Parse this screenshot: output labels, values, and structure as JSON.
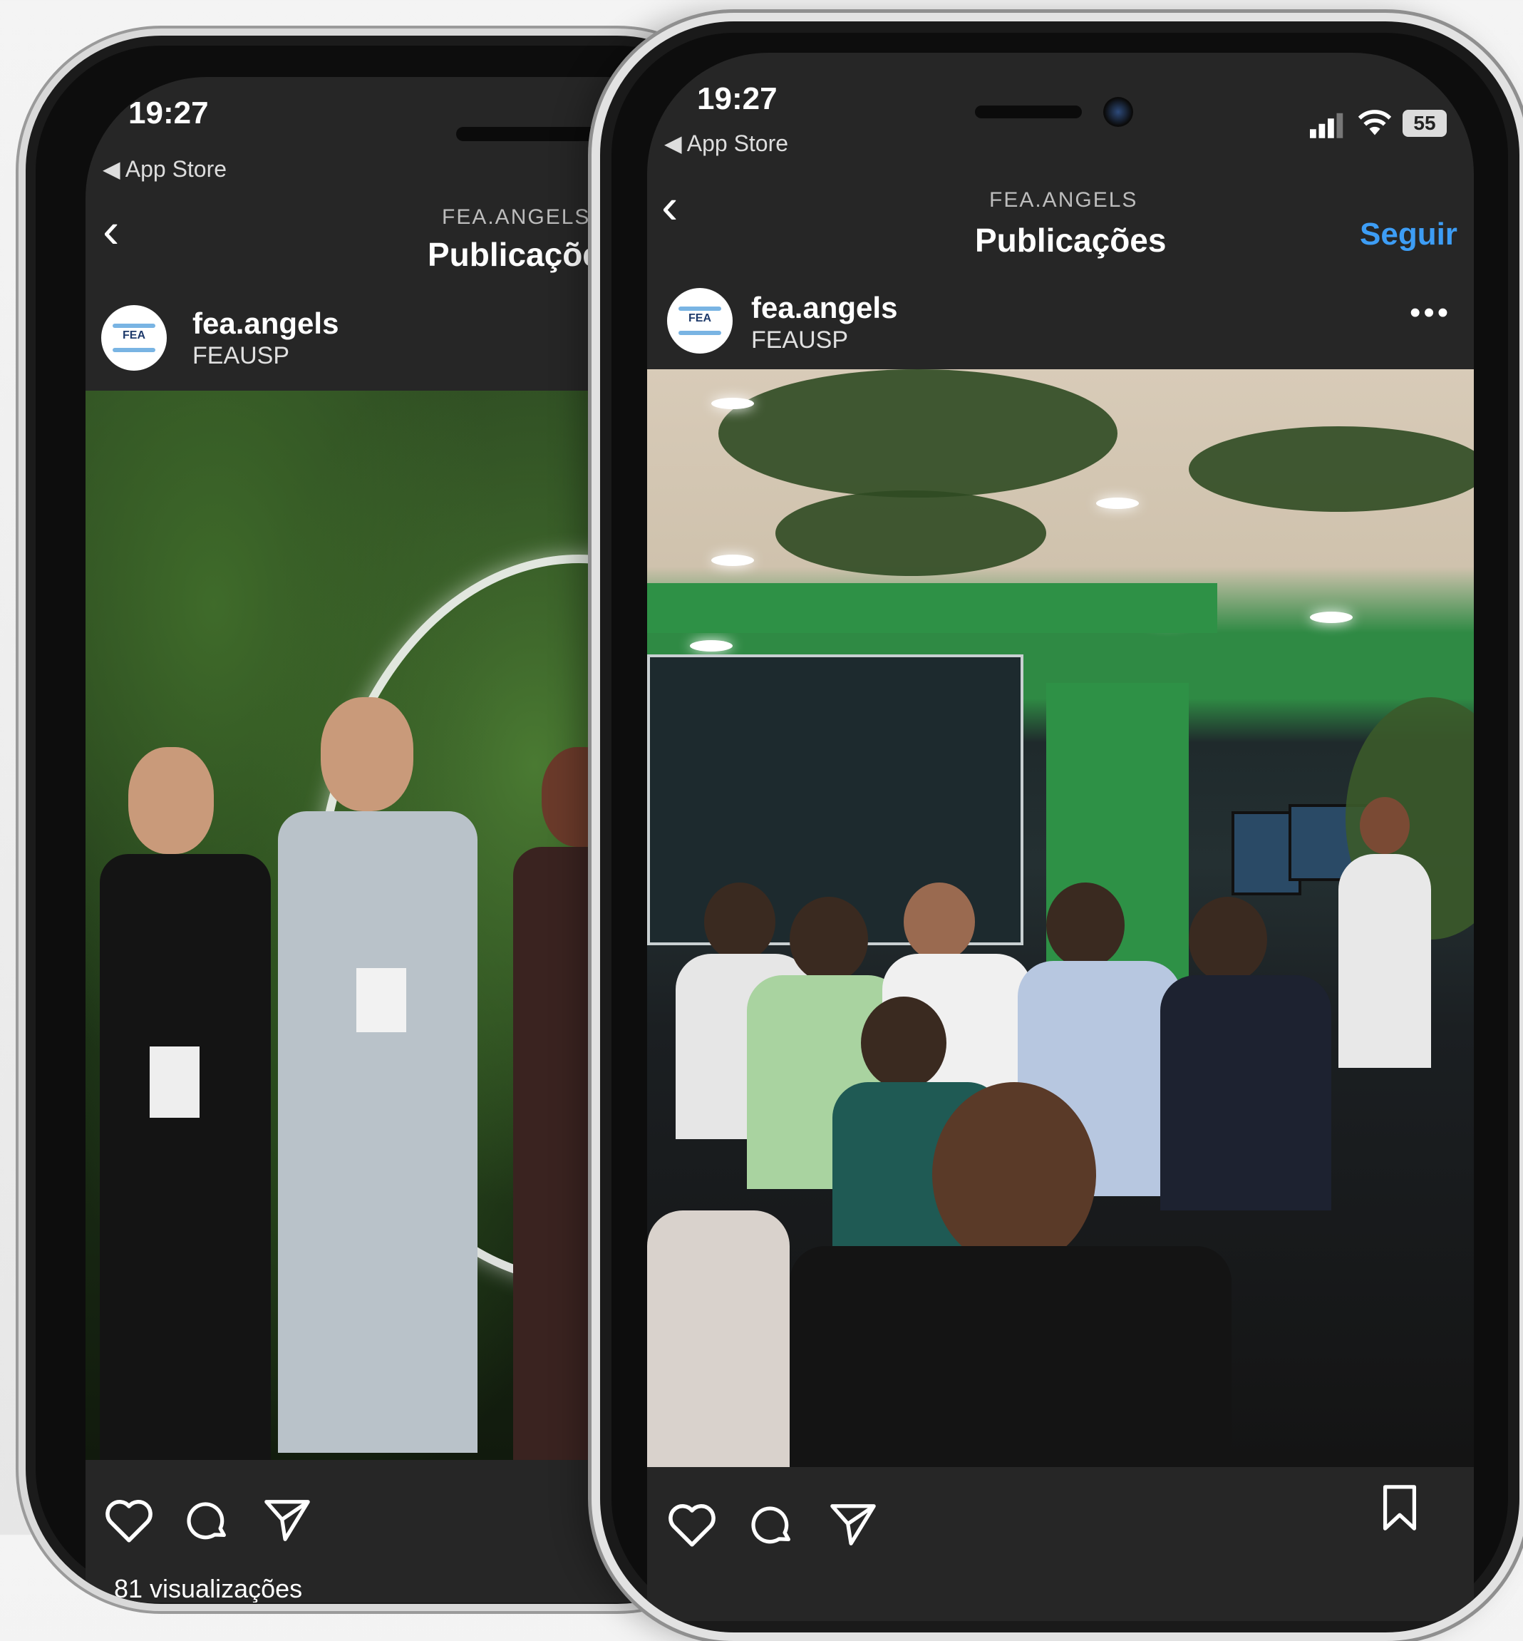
{
  "back_phone": {
    "status": {
      "time": "19:27",
      "back_app": "◀ App Store"
    },
    "nav": {
      "back_glyph": "‹",
      "overline": "FEA.ANGELS",
      "title": "Publicações"
    },
    "post": {
      "username": "fea.angels",
      "location": "FEAUSP",
      "avatar_text": "FEA"
    },
    "footer": {
      "views": "81 visualizações"
    }
  },
  "front_phone": {
    "status": {
      "time": "19:27",
      "back_app": "◀ App Store",
      "battery": "55"
    },
    "nav": {
      "back_glyph": "‹",
      "overline": "FEA.ANGELS",
      "title": "Publicações",
      "follow_label": "Seguir"
    },
    "post": {
      "username": "fea.angels",
      "location": "FEAUSP",
      "avatar_text": "FEA",
      "more_glyph": "•••"
    }
  },
  "colors": {
    "accent": "#3d9df5",
    "screen_bg": "#262626"
  },
  "icons": [
    "heart-icon",
    "comment-icon",
    "share-icon",
    "bookmark-icon",
    "signal-icon",
    "wifi-icon",
    "battery-icon",
    "chevron-left-icon",
    "more-icon"
  ]
}
